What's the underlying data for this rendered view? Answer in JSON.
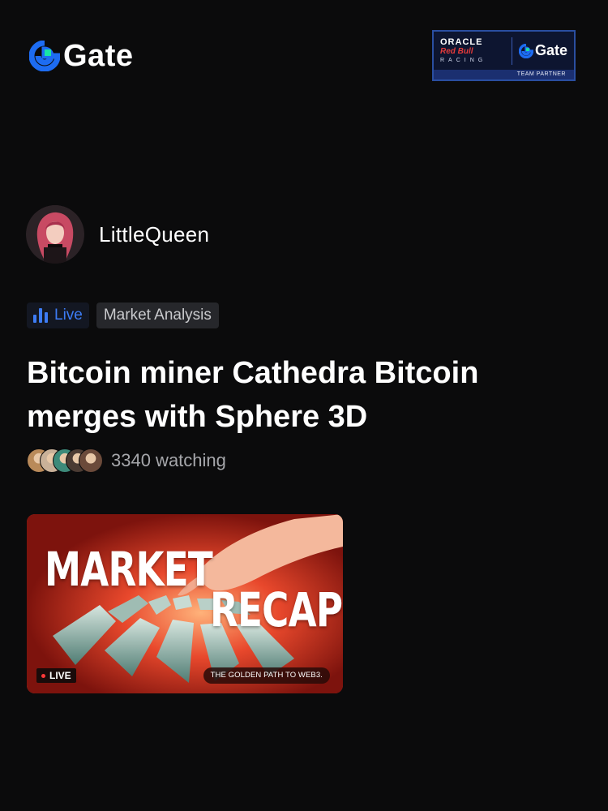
{
  "header": {
    "logo_text": "Gate",
    "logo_icon": "gate-logo-icon",
    "partner": {
      "oracle": "ORACLE",
      "redbull": "Red Bull",
      "racing": "RACING",
      "gate": "Gate",
      "footer": "TEAM PARTNER"
    }
  },
  "host": {
    "name": "LittleQueen"
  },
  "tags": {
    "live": "Live",
    "category": "Market Analysis"
  },
  "stream": {
    "title": "Bitcoin miner Cathedra Bitcoin merges with Sphere 3D",
    "watching": "3340 watching",
    "watcher_avatar_colors": [
      "#b98a5a",
      "#c9b199",
      "#3d8a7a",
      "#4b3b33",
      "#6b4a3a"
    ]
  },
  "thumbnail": {
    "word1": "MARKET",
    "word2": "RECAP",
    "live_badge": "LIVE",
    "slogan": "THE GOLDEN PATH TO WEB3."
  },
  "colors": {
    "background": "#0b0b0c",
    "accent_blue": "#3d7cf5",
    "gate_green": "#17e5a6",
    "thumbnail_red": "#e2452a"
  }
}
